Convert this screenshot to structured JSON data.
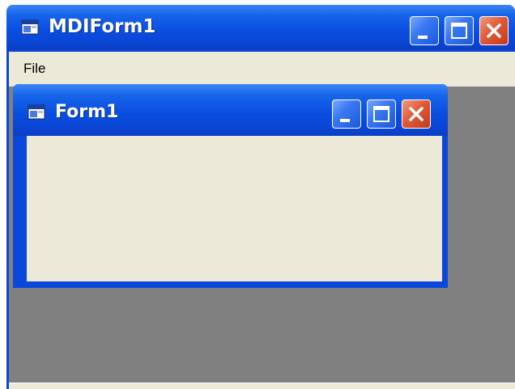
{
  "mdi": {
    "title": "MDIForm1",
    "title_icon": "application-window-icon",
    "menu": {
      "file_label": "File"
    },
    "buttons": {
      "minimize": "minimize-icon",
      "maximize": "maximize-icon",
      "close": "close-icon"
    }
  },
  "child": {
    "title": "Form1",
    "title_icon": "application-window-icon",
    "buttons": {
      "minimize": "minimize-icon",
      "maximize": "maximize-icon",
      "close": "close-icon"
    }
  },
  "colors": {
    "title_blue": "#0a4fe0",
    "client_gray": "#808080",
    "form_face": "#ece9d8",
    "close_red": "#e05a38"
  }
}
